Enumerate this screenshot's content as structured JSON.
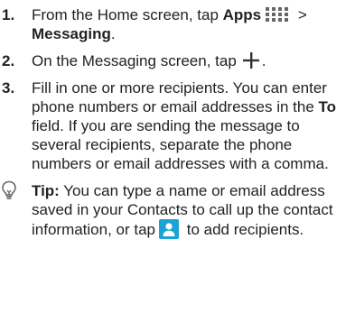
{
  "steps": [
    {
      "number": "1.",
      "part1": "From the Home screen, tap ",
      "apps_label": "Apps",
      "icon": "apps-grid-icon",
      "separator": " >",
      "messaging_label": "Messaging",
      "end": "."
    },
    {
      "number": "2.",
      "text": "On the Messaging screen, tap",
      "icon": "plus-icon",
      "end": "."
    },
    {
      "number": "3.",
      "part1": "Fill in one or more recipients. You can enter phone numbers or email addresses in the ",
      "to_label": "To",
      "part2": " field. If you are sending the message to several recipients, separate the phone numbers or email addresses with a comma."
    }
  ],
  "tip": {
    "icon": "lightbulb-icon",
    "label": "Tip:",
    "part1": " You can type a name or email address saved in your Contacts to call up the contact information, or tap",
    "contacts_icon": "contacts-icon",
    "part2": " to add recipients."
  },
  "colors": {
    "text": "#222222",
    "contacts_icon_bg": "#1aa3d6",
    "icon_gray": "#666666"
  }
}
